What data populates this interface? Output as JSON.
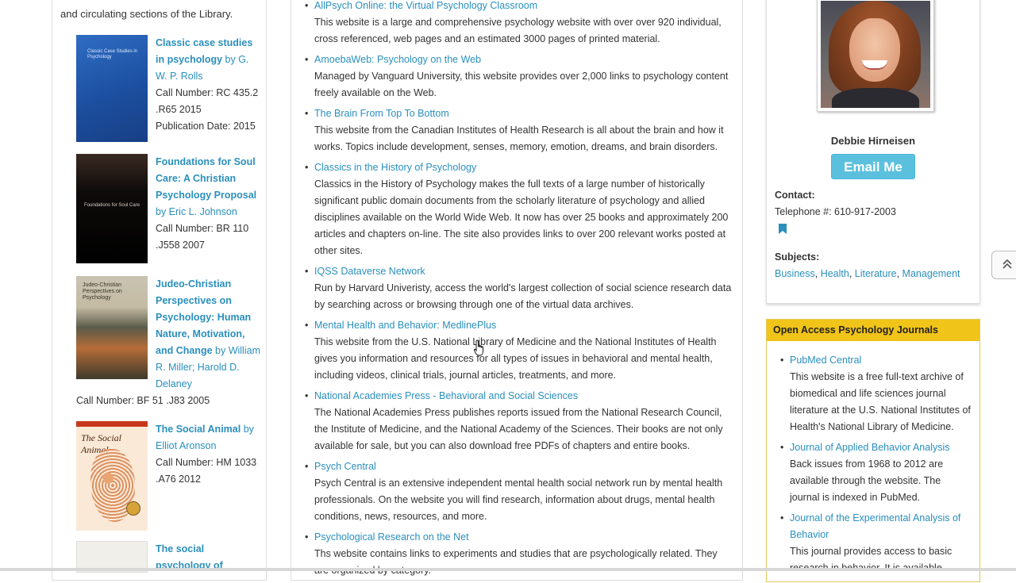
{
  "left": {
    "intro": "and circulating sections of the Library.",
    "books": [
      {
        "title": "Classic case studies in psychology",
        "by": "by G. W. P. Rolls",
        "call_number": "Call Number: RC 435.2 .R65 2015",
        "pub_date": "Publication Date: 2015",
        "cover_text": "Classic Case Studies in Psychology"
      },
      {
        "title": "Foundations for Soul Care: A Christian Psychology Proposal",
        "by": "by Eric L. Johnson",
        "call_number": "Call Number: BR 110 .J558 2007",
        "cover_text": "Foundations for Soul Care"
      },
      {
        "title": "Judeo-Christian Perspectives on Psychology: Human Nature, Motivation, and Change",
        "by": "by William R. Miller; Harold D. Delaney",
        "call_number": "Call Number: BF 51 .J83 2005",
        "cover_text": "Judeo-Christian Perspectives on Psychology"
      },
      {
        "title": "The Social Animal",
        "by": "by Elliot Aronson",
        "call_number": "Call Number: HM 1033 .A76 2012",
        "cover_text": "The Social Animal"
      },
      {
        "title": "The social psychology of"
      }
    ]
  },
  "center": {
    "items": [
      {
        "name": "AllPsych Online: the Virtual Psychology Classroom",
        "desc": "This website is a large and comprehensive psychology website with over over 920 individual, cross referenced, web pages and an estimated 3000 pages of printed material."
      },
      {
        "name": "AmoebaWeb: Psychology on the Web",
        "desc": "Managed by Vanguard University, this website provides over 2,000 links to psychology content freely available on the Web."
      },
      {
        "name": "The Brain From Top To Bottom",
        "desc": "This website from the Canadian Institutes of Health Research is all about the brain and how it works. Topics include development, senses, memory, emotion, dreams, and brain disorders."
      },
      {
        "name": "Classics in the History of Psychology",
        "desc": "Classics in the History of Psychology makes the full texts of a large number of historically significant public domain documents from the scholarly literature of psychology and allied disciplines available on the World Wide Web. It now has over 25 books and approximately 200 articles and chapters on-line. The site also provides links to over 200 relevant works posted at other sites."
      },
      {
        "name": "IQSS Dataverse Network",
        "desc": "Run by Harvard Univeristy, access the world's largest collection of social science research data by searching across or browsing through one of the virtual data archives."
      },
      {
        "name": "Mental Health and Behavior: MedlinePlus",
        "desc": "This website from the U.S. National Library of Medicine and the National Institutes of Health gives you information and resources for all types of issues in behavioral and mental health, including videos, clinical trials, journal articles, treatments, and more."
      },
      {
        "name": "National Academies Press - Behavioral and Social Sciences",
        "desc": "The National Academies Press publishes reports issued from the National Research Council, the Institute of Medicine, and the National Academy of the Sciences. Their books are not only available for sale, but you can also download free PDFs of chapters and entire books."
      },
      {
        "name": "Psych Central",
        "desc": "Psych Central is an extensive independent mental health social network run by mental health professionals. On the website you will find research, information about drugs, mental health conditions, news, resources, and more."
      },
      {
        "name": "Psychological Research on the Net",
        "desc": "Ths website contains links to experiments and studies that are psychologically related. They are organized by category."
      }
    ]
  },
  "profile": {
    "name": "Debbie Hirneisen",
    "email_button": "Email Me",
    "contact_label": "Contact:",
    "phone": "Telephone #: 610-917-2003",
    "subjects_label": "Subjects:",
    "subjects": [
      "Business",
      "Health",
      "Literature",
      "Management"
    ]
  },
  "journals": {
    "header": "Open Access Psychology Journals",
    "items": [
      {
        "name": "PubMed Central",
        "desc": "This website is a free full-text archive of biomedical and life sciences journal literature at the U.S. National Institutes of Health's National Library of Medicine."
      },
      {
        "name": "Journal of Applied Behavior Analysis",
        "desc": "Back issues from 1968 to 2012 are available through the website. The journal is indexed in PubMed."
      },
      {
        "name": "Journal of the Experimental Analysis of Behavior",
        "desc": "This journal provides access to basic research in behavior. It is available"
      }
    ]
  },
  "colors": {
    "link": "#2a8fbd",
    "email_button": "#5bc0de",
    "journal_header": "#f0c419"
  },
  "icons": {
    "bookmark": "bookmark-icon",
    "back_to_top": "chevron-up-icon",
    "cursor": "hand-pointer-icon"
  }
}
